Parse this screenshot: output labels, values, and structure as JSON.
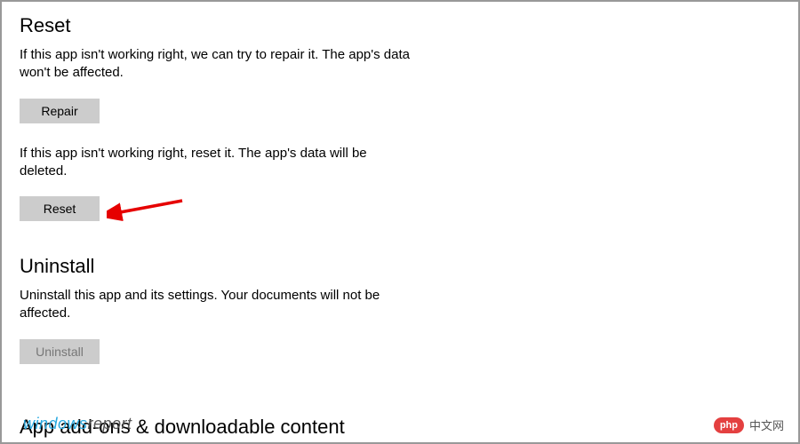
{
  "reset": {
    "heading": "Reset",
    "repair_desc": "If this app isn't working right, we can try to repair it. The app's data won't be affected.",
    "repair_label": "Repair",
    "reset_desc": "If this app isn't working right, reset it. The app's data will be deleted.",
    "reset_label": "Reset"
  },
  "uninstall": {
    "heading": "Uninstall",
    "desc": "Uninstall this app and its settings. Your documents will not be affected.",
    "button_label": "Uninstall"
  },
  "addons": {
    "heading": "App add-ons & downloadable content"
  },
  "watermark": {
    "wr_part1": "windows",
    "wr_part2": "report",
    "php_badge": "php",
    "php_text": "中文网"
  }
}
